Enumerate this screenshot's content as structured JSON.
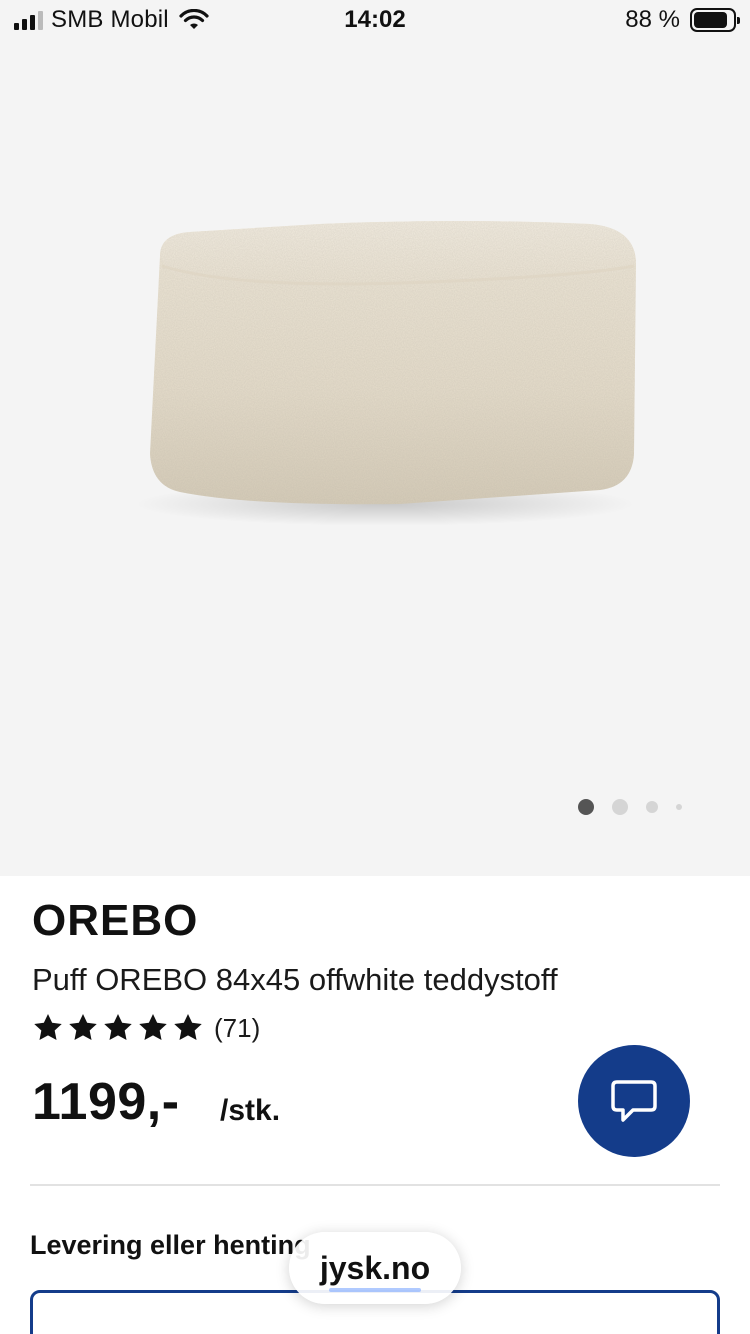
{
  "status_bar": {
    "carrier": "SMB Mobil",
    "time": "14:02",
    "battery_percent": "88 %",
    "battery_level": 0.88,
    "signal_bars": 3
  },
  "gallery": {
    "image_subject": "Puff OREBO offwhite teddystoff",
    "slide_count": 4,
    "active_slide": 1
  },
  "product": {
    "brand": "OREBO",
    "title": "Puff OREBO 84x45 offwhite teddystoff",
    "rating_stars": 5,
    "rating_count": "(71)",
    "price": "1199,-",
    "unit": "/stk."
  },
  "chat": {
    "icon": "chat-bubble-icon"
  },
  "delivery": {
    "heading": "Levering eller henting"
  },
  "browser": {
    "url": "jysk.no"
  },
  "colors": {
    "accent": "#143c8a",
    "gallery_bg": "#f4f4f4",
    "product_color": "#ece5d6"
  }
}
